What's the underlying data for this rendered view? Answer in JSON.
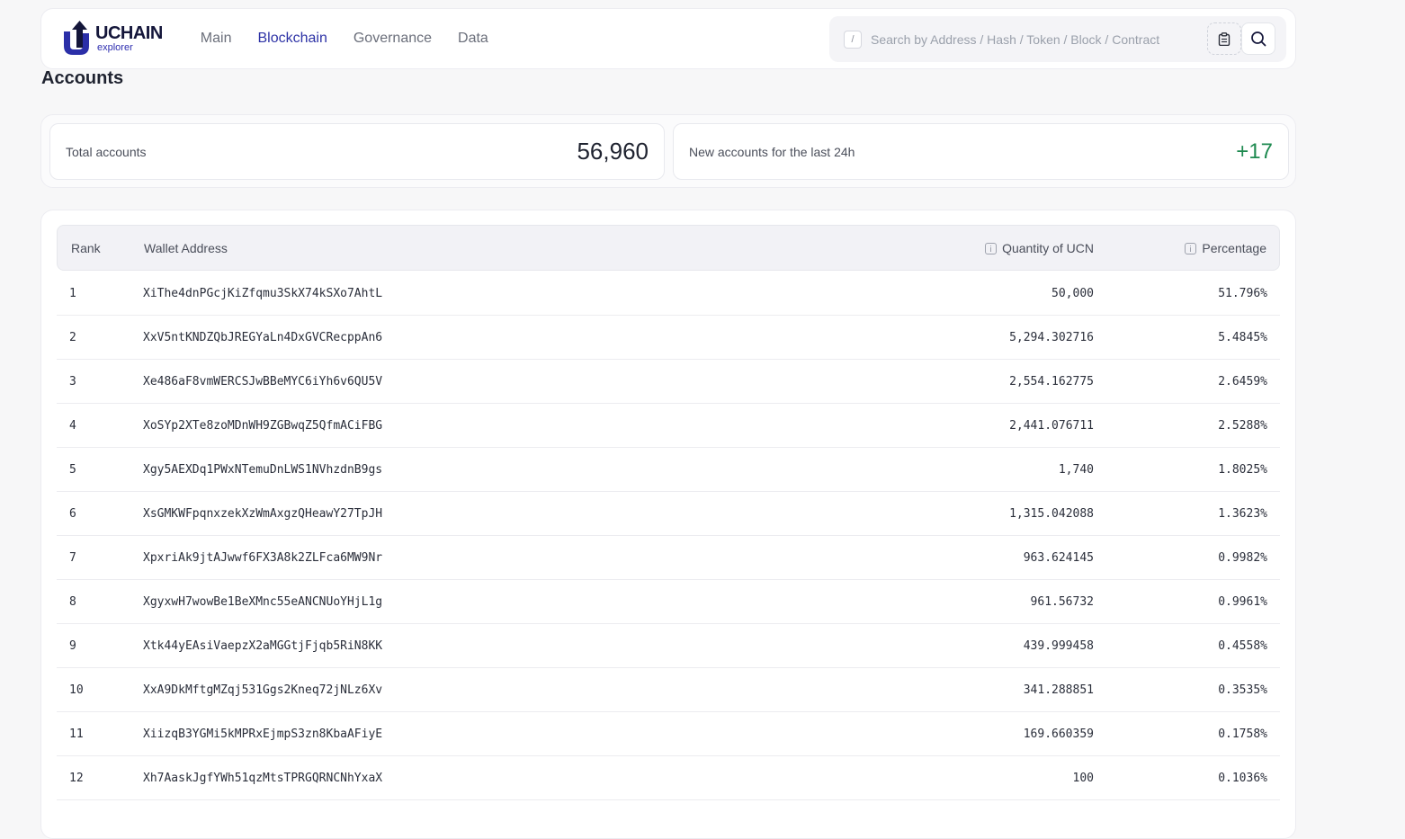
{
  "brand": {
    "title": "UCHAIN",
    "subtitle": "explorer"
  },
  "nav": [
    {
      "label": "Main",
      "active": false
    },
    {
      "label": "Blockchain",
      "active": true
    },
    {
      "label": "Governance",
      "active": false
    },
    {
      "label": "Data",
      "active": false
    }
  ],
  "search": {
    "shortcut": "/",
    "placeholder": "Search by Address / Hash / Token / Block / Contract",
    "icons": [
      "clipboard-icon",
      "search-icon"
    ]
  },
  "page_title": "Accounts",
  "stats": {
    "total_label": "Total accounts",
    "total_value": "56,960",
    "new_label": "New accounts for the last 24h",
    "new_value": "+17"
  },
  "table": {
    "headers": {
      "rank": "Rank",
      "address": "Wallet Address",
      "quantity": "Quantity of UCN",
      "percentage": "Percentage"
    },
    "rows": [
      {
        "rank": "1",
        "address": "XiThe4dnPGcjKiZfqmu3SkX74kSXo7AhtL",
        "quantity": "50,000",
        "percentage": "51.796%"
      },
      {
        "rank": "2",
        "address": "XxV5ntKNDZQbJREGYaLn4DxGVCReсppAn6",
        "quantity": "5,294.302716",
        "percentage": "5.4845%"
      },
      {
        "rank": "3",
        "address": "Xe486aF8vmWERCSJwBBeMYC6iYh6v6QU5V",
        "quantity": "2,554.162775",
        "percentage": "2.6459%"
      },
      {
        "rank": "4",
        "address": "XoSYp2XTe8zoMDnWH9ZGBwqZ5QfmACiFBG",
        "quantity": "2,441.076711",
        "percentage": "2.5288%"
      },
      {
        "rank": "5",
        "address": "Xgy5AEXDq1PWxNTemuDnLWS1NVhzdnB9gs",
        "quantity": "1,740",
        "percentage": "1.8025%"
      },
      {
        "rank": "6",
        "address": "XsGMKWFpqnxzekXzWmAxgzQHeawY27TpJH",
        "quantity": "1,315.042088",
        "percentage": "1.3623%"
      },
      {
        "rank": "7",
        "address": "XpxriAk9jtAJwwf6FX3A8k2ZLFca6MW9Nr",
        "quantity": "963.624145",
        "percentage": "0.9982%"
      },
      {
        "rank": "8",
        "address": "XgyxwH7wowBe1BeXMnc55eANCNUoYHjL1g",
        "quantity": "961.56732",
        "percentage": "0.9961%"
      },
      {
        "rank": "9",
        "address": "Xtk44yEAsiVaepzX2aMGGtjFjqb5RiN8KK",
        "quantity": "439.999458",
        "percentage": "0.4558%"
      },
      {
        "rank": "10",
        "address": "XxA9DkMftgMZqj531Ggs2Kneq72jNLz6Xv",
        "quantity": "341.288851",
        "percentage": "0.3535%"
      },
      {
        "rank": "11",
        "address": "XiizqB3YGMi5kMPRxEjmpS3zn8KbaAFiyE",
        "quantity": "169.660359",
        "percentage": "0.1758%"
      },
      {
        "rank": "12",
        "address": "Xh7AaskJgfYWh51qzMtsTPRGQRNCNhYxaX",
        "quantity": "100",
        "percentage": "0.1036%"
      }
    ]
  },
  "colors": {
    "accent": "#2e33a6",
    "positive": "#1e8a50"
  }
}
